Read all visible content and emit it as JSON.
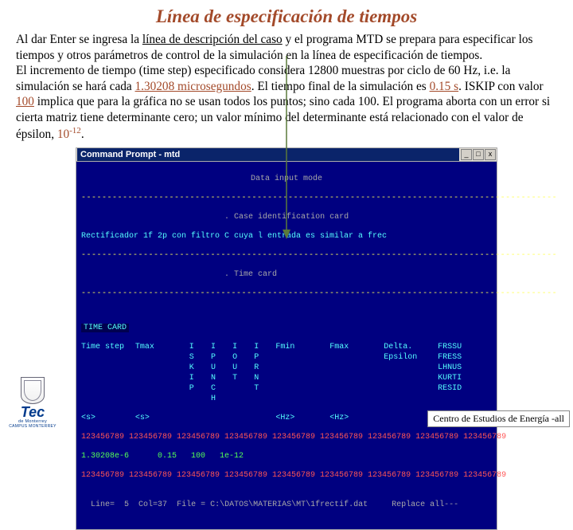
{
  "title": "Línea de especificación de tiempos",
  "para": {
    "p1a": "Al dar Enter se ingresa la ",
    "p1b": "línea de descripción del caso",
    "p1c": " y el programa MTD se prepara para especificar los tiempos y otros parámetros de control de la simulación en la línea de especificación de tiempos.",
    "p2a": "El incremento de tiempo (time step) especificado considera 12800 muestras por ciclo de 60 Hz, i.e. la simulación se hará cada ",
    "p2b": "1.30208 microsegundos",
    "p2c": ".  El tiempo final de la simulación es ",
    "p2d": "0.15 s",
    "p2e": ".  ISKIP con valor ",
    "p2f": "100",
    "p2g": " implica que para la gráfica no se usan todos los puntos; sino cada 100.  El programa aborta con un error si cierta matriz tiene determinante cero; un valor mínimo del determinante está relacionado con el valor de épsilon, ",
    "p2h": "10",
    "p2i": "-12",
    "p2j": "."
  },
  "window": {
    "caption": "Command Prompt - mtd",
    "min": "_",
    "max": "□",
    "close": "x"
  },
  "term": {
    "mode": "Data input mode",
    "card1": "Case identification card",
    "case": "Rectificador 1f 2p con filtro C cuya l entrada es similar a frec",
    "card2": "Time card",
    "dots": "--------------------------------------------------------------------------------------------",
    "ruler": "123456789 123456789 123456789 123456789 123456789 123456789 123456789 123456789 123456789",
    "hdr_time": "TIME CARD",
    "row1": {
      "c1": "Time step",
      "c2": "Tmax",
      "c3": "I\nS\nK\nI\nP",
      "c4": "I\nP\nU\nN\nC\nH",
      "c5": "I\nO\nU\nT",
      "c6": "I\nP\nR\nN\nT",
      "c7": "Fmin",
      "c8": "Fmax",
      "c9": "Delta.\nEpsilon",
      "c10": "FRSSU\nFRESS\nLHNUS\nKURTI\nRESID"
    },
    "row_units": {
      "u1": "<s>",
      "u2": "<s>",
      "u3": "",
      "u4": "<Hz>",
      "u5": "<Hz>"
    },
    "values": {
      "v1": "1.30208e-6",
      "v2": "   0.15",
      "v3": "100",
      "v4": "1e-12"
    },
    "status": {
      "s1": "Line=  5",
      "s2": "Col=37",
      "s3": "File = C:\\DATOS\\MATERIAS\\MT\\1frectif.dat",
      "s4": "Replace all---"
    }
  },
  "footer": "Centro de Estudios de Energía -all",
  "logo": {
    "brand": "Tec",
    "sub1": "de Monterrey",
    "sub2": "CAMPUS MONTERREY"
  }
}
